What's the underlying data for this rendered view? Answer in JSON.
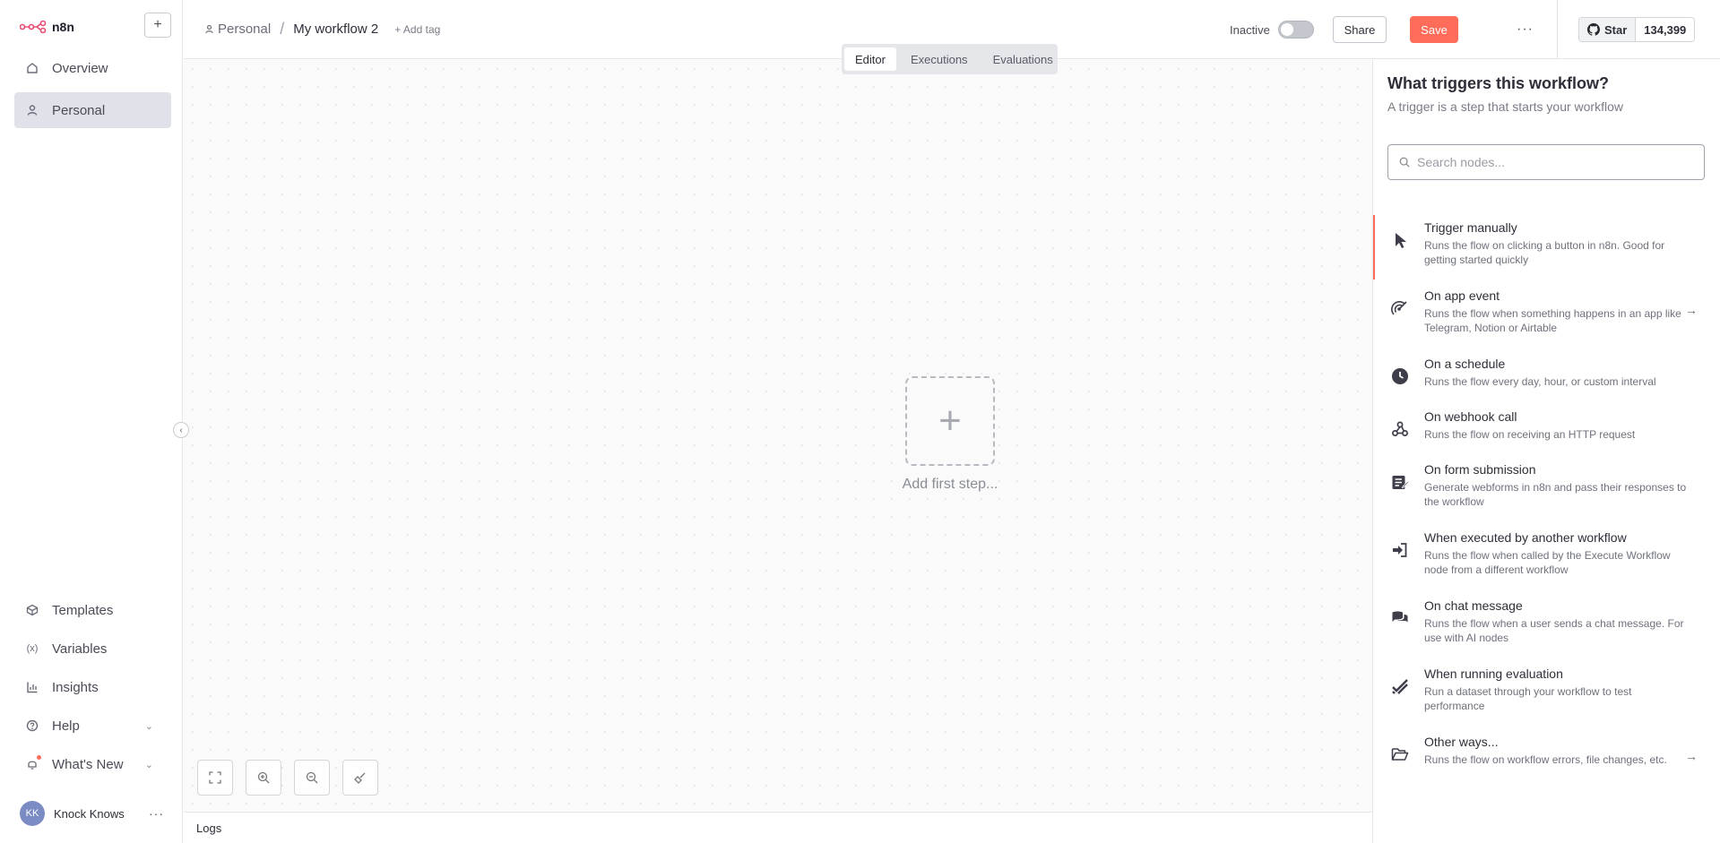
{
  "app": {
    "logo_text": "n8n",
    "new_button": "+"
  },
  "sidebar": {
    "top_items": [
      {
        "label": "Overview",
        "icon": "home-icon"
      },
      {
        "label": "Personal",
        "icon": "user-icon"
      }
    ],
    "bottom_items": [
      {
        "label": "Templates",
        "icon": "box-icon"
      },
      {
        "label": "Variables",
        "icon": "variable-icon"
      },
      {
        "label": "Insights",
        "icon": "chart-icon"
      },
      {
        "label": "Help",
        "icon": "help-icon"
      },
      {
        "label": "What's New",
        "icon": "bell-icon"
      }
    ],
    "user": {
      "initials": "KK",
      "name": "Knock Knows",
      "more": "···"
    }
  },
  "header": {
    "breadcrumb_parent": "Personal",
    "breadcrumb_sep": "/",
    "workflow_name": "My workflow 2",
    "add_tag": "+ Add tag",
    "status": "Inactive",
    "share": "Share",
    "save": "Save",
    "more": "···",
    "github": {
      "star": "Star",
      "count": "134,399"
    }
  },
  "tabs": [
    "Editor",
    "Executions",
    "Evaluations"
  ],
  "canvas": {
    "add_first_plus": "+",
    "add_first_label": "Add first step..."
  },
  "logs": {
    "label": "Logs"
  },
  "panel": {
    "title": "What triggers this workflow?",
    "subtitle": "A trigger is a step that starts your workflow",
    "search_placeholder": "Search nodes...",
    "items": [
      {
        "title": "Trigger manually",
        "desc": "Runs the flow on clicking a button in n8n. Good for getting started quickly",
        "icon": "cursor-icon"
      },
      {
        "title": "On app event",
        "desc": "Runs the flow when something happens in an app like Telegram, Notion or Airtable",
        "icon": "signal-icon"
      },
      {
        "title": "On a schedule",
        "desc": "Runs the flow every day, hour, or custom interval",
        "icon": "clock-icon"
      },
      {
        "title": "On webhook call",
        "desc": "Runs the flow on receiving an HTTP request",
        "icon": "webhook-icon"
      },
      {
        "title": "On form submission",
        "desc": "Generate webforms in n8n and pass their responses to the workflow",
        "icon": "form-icon"
      },
      {
        "title": "When executed by another workflow",
        "desc": "Runs the flow when called by the Execute Workflow node from a different workflow",
        "icon": "sign-in-icon"
      },
      {
        "title": "On chat message",
        "desc": "Runs the flow when a user sends a chat message. For use with AI nodes",
        "icon": "chat-icon"
      },
      {
        "title": "When running evaluation",
        "desc": "Run a dataset through your workflow to test performance",
        "icon": "check-double-icon"
      },
      {
        "title": "Other ways...",
        "desc": "Runs the flow on workflow errors, file changes, etc.",
        "icon": "folder-icon"
      }
    ]
  }
}
